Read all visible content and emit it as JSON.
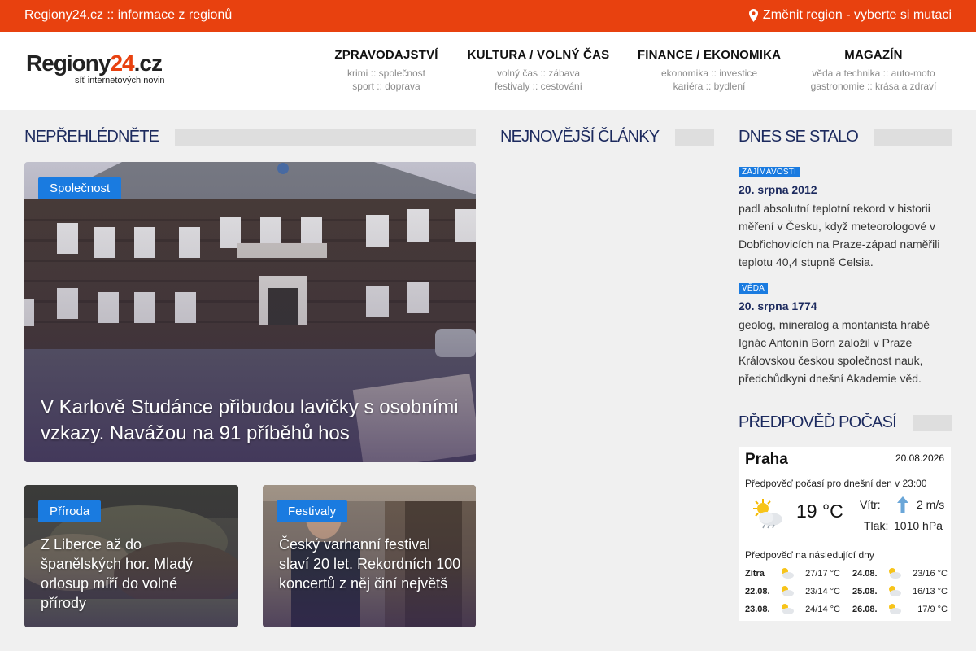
{
  "topbar": {
    "site_text": "Regiony24.cz :: informace z regionů",
    "region_text": "Změnit region - vyberte si mutaci"
  },
  "logo": {
    "word_main": "Regiony",
    "word_num": "24",
    "word_tld": ".cz",
    "tagline": "síť internetových novin"
  },
  "nav": [
    {
      "title": "ZPRAVODAJSTVÍ",
      "sub1": "krimi :: společnost",
      "sub2": "sport :: doprava"
    },
    {
      "title": "KULTURA / VOLNÝ ČAS",
      "sub1": "volný čas :: zábava",
      "sub2": "festivaly :: cestování"
    },
    {
      "title": "FINANCE / EKONOMIKA",
      "sub1": "ekonomika :: investice",
      "sub2": "kariéra :: bydlení"
    },
    {
      "title": "MAGAZÍN",
      "sub1": "věda a technika :: auto-moto",
      "sub2": "gastronomie :: krása a zdraví"
    }
  ],
  "sections": {
    "dont_miss": "NEPŘEHLÉDNĚTE",
    "latest": "NEJNOVĚJŠÍ ČLÁNKY",
    "today": "DNES SE STALO",
    "weather": "PŘEDPOVĚĎ POČASÍ"
  },
  "articles": [
    {
      "badge": "Společnost",
      "headline": "V Karlově Studánce přibudou lavičky s osobními vzkazy. Navážou na 91 příběhů hos"
    },
    {
      "badge": "Příroda",
      "headline": "Z Liberce až do španělských hor. Mladý orlosup míří do volné přírody"
    },
    {
      "badge": "Festivaly",
      "headline": "Český varhanní festival slaví 20 let. Rekordních 100 koncertů z něj činí největš"
    }
  ],
  "events": [
    {
      "tag": "ZAJÍMAVOSTI",
      "date": "20. srpna 2012",
      "text": "padl absolutní teplotní rekord v historii měření v Česku, když meteorologové v Dobřichovicích na Praze-západ naměřili teplotu 40,4 stupně Celsia."
    },
    {
      "tag": "VĚDA",
      "date": "20. srpna 1774",
      "text": "geolog, mineralog a montanista hrabě Ignác Antonín Born založil v Praze Královskou českou společnost nauk, předchůdkyni dnešní Akademie věd."
    }
  ],
  "weather": {
    "city": "Praha",
    "date": "20.08.2026",
    "forecast_label": "Předpověď počasí pro dnešní den v 23:00",
    "temp": "19 °C",
    "wind_label": "Vítr:",
    "wind_value": "2 m/s",
    "pressure_label": "Tlak:",
    "pressure_value": "1010 hPa",
    "next_label": "Předpověď na následující dny",
    "icon": "partly-cloudy-sun-icon",
    "days": [
      {
        "day": "Zítra",
        "temp": "27/17 °C"
      },
      {
        "day": "22.08.",
        "temp": "23/14 °C"
      },
      {
        "day": "23.08.",
        "temp": "24/14 °C"
      },
      {
        "day": "24.08.",
        "temp": "23/16 °C"
      },
      {
        "day": "25.08.",
        "temp": "16/13 °C"
      },
      {
        "day": "26.08.",
        "temp": "17/9 °C"
      }
    ]
  },
  "colors": {
    "topbar": "#e8410f",
    "accent_blue": "#1a7be0",
    "heading_navy": "#1c2a5e"
  }
}
